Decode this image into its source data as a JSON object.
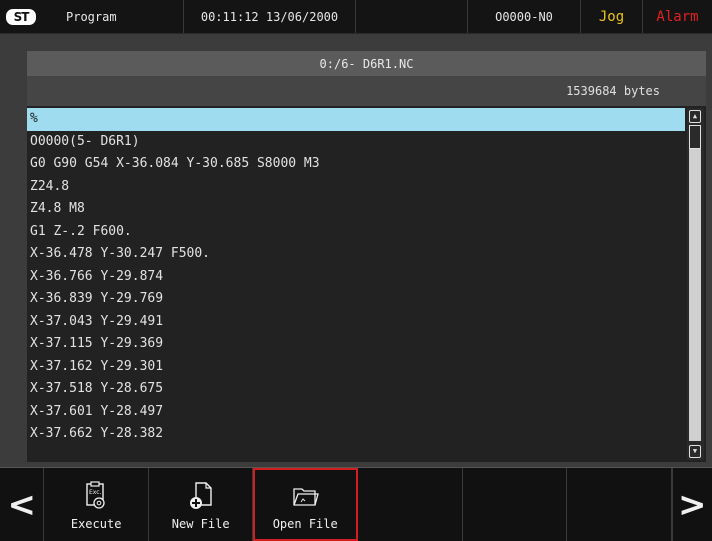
{
  "topbar": {
    "logo": "ST",
    "screen": "Program",
    "datetime": "00:11:12 13/06/2000",
    "program_no": "O0000-N0",
    "mode": "Jog",
    "alarm": "Alarm"
  },
  "file": {
    "name": "0:/6- D6R1.NC",
    "size": "1539684 bytes"
  },
  "code_lines": [
    "%",
    "O0000(5- D6R1)",
    "G0 G90 G54 X-36.084 Y-30.685 S8000 M3",
    "Z24.8",
    "Z4.8 M8",
    "G1 Z-.2 F600.",
    "X-36.478 Y-30.247 F500.",
    "X-36.766 Y-29.874",
    "X-36.839 Y-29.769",
    "X-37.043 Y-29.491",
    "X-37.115 Y-29.369",
    "X-37.162 Y-29.301",
    "X-37.518 Y-28.675",
    "X-37.601 Y-28.497",
    "X-37.662 Y-28.382"
  ],
  "softkeys": {
    "execute": "Execute",
    "new_file": "New File",
    "open_file": "Open File",
    "execute_icon_text": "Exc."
  },
  "icons": {
    "prev": "chevron-left-icon",
    "next": "chevron-right-icon"
  },
  "colors": {
    "mode": "#e8c51b",
    "alarm": "#e02020",
    "selection": "#9fdcef",
    "active_outline": "#d21e1e"
  }
}
